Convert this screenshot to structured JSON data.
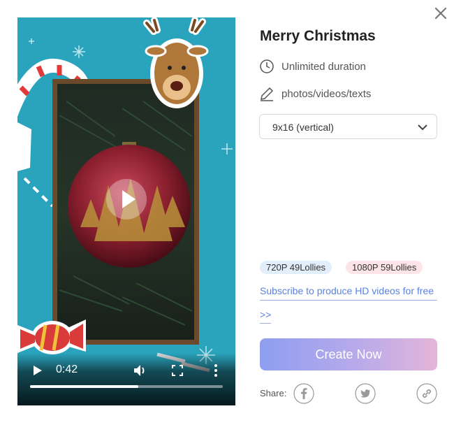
{
  "header": {
    "close_icon": "close-icon"
  },
  "video": {
    "current_time": "0:42",
    "progress_fraction": 0.56,
    "icons": {
      "play_overlay": "play-icon",
      "play": "play-icon",
      "volume": "volume-icon",
      "fullscreen": "fullscreen-icon",
      "more": "more-vertical-icon"
    }
  },
  "details": {
    "title": "Merry Christmas",
    "duration": {
      "icon": "clock-icon",
      "text": "Unlimited duration"
    },
    "media": {
      "icon": "pencil-icon",
      "text": "photos/videos/texts"
    },
    "aspect_select": {
      "value": "9x16 (vertical)",
      "icon": "chevron-down-icon"
    }
  },
  "pricing": {
    "badge_720": "720P 49Lollies",
    "badge_1080": "1080P 59Lollies",
    "subscribe_line1": "Subscribe to produce HD videos for free",
    "subscribe_line2": ">>"
  },
  "actions": {
    "create_label": "Create Now",
    "share_label": "Share:",
    "share_icons": [
      "facebook-icon",
      "twitter-icon",
      "link-icon"
    ]
  },
  "colors": {
    "accent_blue": "#5b82e0",
    "gradient_start": "#8e9ef0",
    "gradient_end": "#e4b5d9",
    "badge_blue_bg": "#e3eefb",
    "badge_pink_bg": "#fde4e8",
    "video_bg": "#2aa4bd"
  }
}
